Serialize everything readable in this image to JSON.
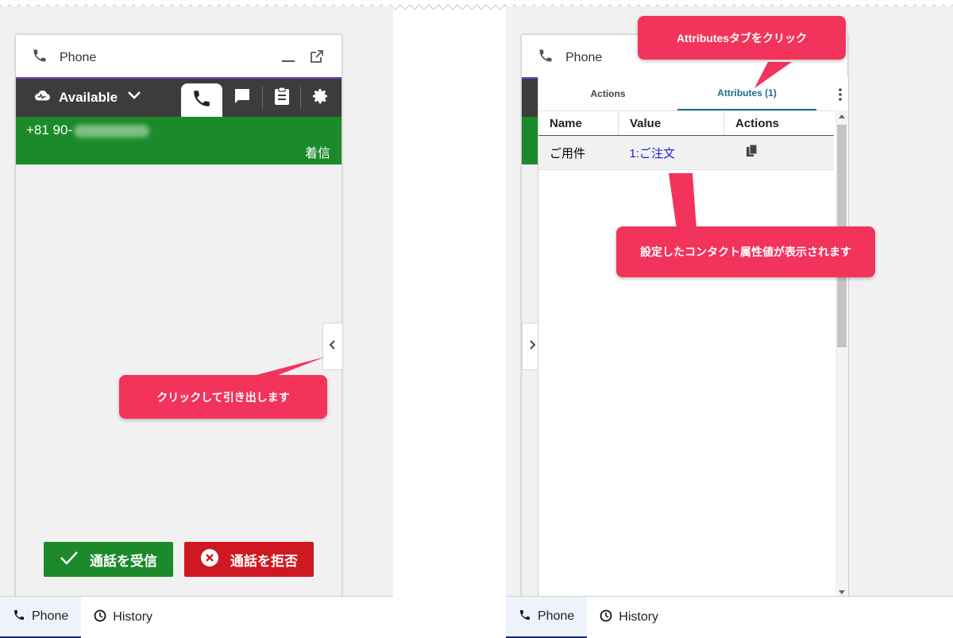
{
  "left": {
    "title": "Phone",
    "status": "Available",
    "caller_number": "+81 90-",
    "call_state": "着信",
    "accept_label": "通話を受信",
    "reject_label": "通話を拒否",
    "callout": "クリックして引き出します"
  },
  "right": {
    "title": "Phone",
    "tabs": [
      "Actions",
      "Attributes (1)"
    ],
    "columns": [
      "Name",
      "Value",
      "Actions"
    ],
    "rows": [
      {
        "name": "ご用件",
        "value": "1:ご注文"
      }
    ],
    "callout_top": "Attributesタブをクリック",
    "callout_mid": "設定したコンタクト属性値が表示されます"
  },
  "bottom_tabs": {
    "phone": "Phone",
    "history": "History"
  },
  "colors": {
    "green": "#1c8a2a",
    "red": "#d01823",
    "callout": "#f2335c",
    "dark": "#3c3c3c",
    "accent_tab": "#1f6e8c"
  },
  "icons": [
    "phone-icon",
    "minimize-icon",
    "popout-icon",
    "cloud-status-icon",
    "chevron-down-icon",
    "chat-icon",
    "clipboard-icon",
    "gear-icon",
    "check-icon",
    "close-circle-icon",
    "chevron-left-icon",
    "chevron-right-icon",
    "copy-icon",
    "kebab-icon",
    "clock-icon"
  ]
}
